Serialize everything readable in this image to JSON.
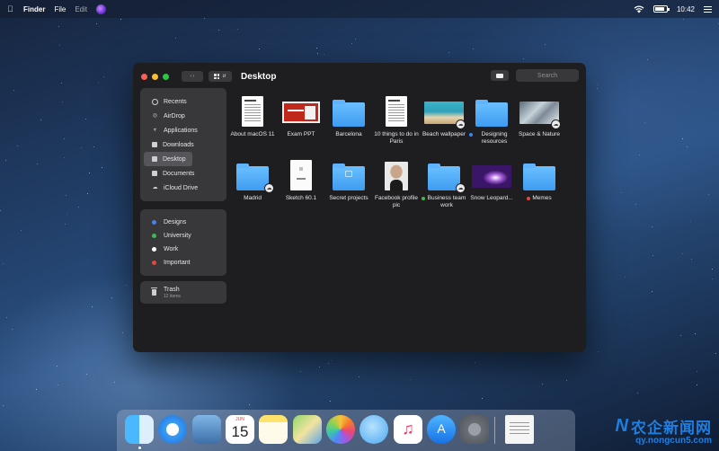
{
  "menubar": {
    "app_name": "Finder",
    "items": [
      "File",
      "Edit"
    ],
    "time": "10:42",
    "battery_level": 0.8
  },
  "window": {
    "title": "Desktop",
    "search_placeholder": "Search",
    "sidebar": {
      "items": [
        {
          "label": "Recents",
          "icon": "clock-icon"
        },
        {
          "label": "AirDrop",
          "icon": "airdrop-icon"
        },
        {
          "label": "Applications",
          "icon": "applications-icon"
        },
        {
          "label": "Downloads",
          "icon": "downloads-icon"
        },
        {
          "label": "Desktop",
          "icon": "desktop-icon",
          "active": true
        },
        {
          "label": "Documents",
          "icon": "documents-icon"
        },
        {
          "label": "iCloud Drive",
          "icon": "cloud-icon"
        }
      ],
      "tags": [
        {
          "label": "Designs",
          "color": "#3d86f2"
        },
        {
          "label": "University",
          "color": "#3fb950"
        },
        {
          "label": "Work",
          "color": "#ffffff"
        },
        {
          "label": "Important",
          "color": "#e0493c"
        }
      ],
      "trash": {
        "label": "Trash",
        "count": "12 items"
      }
    },
    "files": [
      {
        "name": "About macOS 11",
        "type": "document"
      },
      {
        "name": "Exam PPT",
        "type": "presentation"
      },
      {
        "name": "Barcelona",
        "type": "folder"
      },
      {
        "name": "10 things to do in Paris",
        "type": "document"
      },
      {
        "name": "Beach wallpaper",
        "type": "image-beach",
        "icloud": true
      },
      {
        "name": "Designing resources",
        "type": "folder",
        "tag_color": "#3d86f2"
      },
      {
        "name": "Space & Nature",
        "type": "image-space",
        "icloud": true
      },
      {
        "name": "Madrid",
        "type": "folder",
        "icloud": true
      },
      {
        "name": "Sketch 60.1",
        "type": "sketch-document"
      },
      {
        "name": "Secret projects",
        "type": "folder-locked"
      },
      {
        "name": "Facebook profile pic",
        "type": "image-portrait"
      },
      {
        "name": "Business team work",
        "type": "folder",
        "icloud": true,
        "tag_color": "#3fb950"
      },
      {
        "name": "Snow Leopard...",
        "type": "image-leopard"
      },
      {
        "name": "Memes",
        "type": "folder",
        "tag_color": "#e0493c"
      }
    ]
  },
  "dock": {
    "apps": [
      "Finder",
      "Safari",
      "Preview",
      "Calendar",
      "Notes",
      "Maps",
      "Photos",
      "Messages",
      "Music",
      "App Store",
      "System Preferences",
      "Document"
    ],
    "calendar_month": "JUN",
    "calendar_day": "15"
  },
  "watermark": {
    "cn": "农企新闻网",
    "url": "qy.nongcun5.com"
  }
}
